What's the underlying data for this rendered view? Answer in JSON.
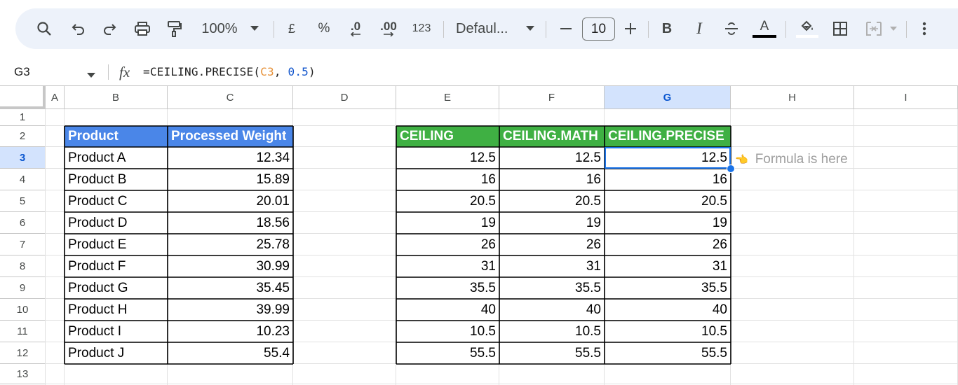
{
  "toolbar": {
    "zoom": "100%",
    "currency": "£",
    "percent": "%",
    "dec_decrease": ".0",
    "dec_increase": ".00",
    "number_format": "123",
    "font_name": "Defaul...",
    "minus": "—",
    "font_size": "10",
    "plus": "+",
    "bold": "B",
    "italic": "I",
    "text_color": "A"
  },
  "formula_bar": {
    "cell_ref": "G3",
    "fx": "fx",
    "formula_prefix": "=CEILING.PRECISE(",
    "formula_ref": "C3",
    "formula_sep": ", ",
    "formula_num": "0.5",
    "formula_suffix": ")"
  },
  "columns": [
    "A",
    "B",
    "C",
    "D",
    "E",
    "F",
    "G",
    "H",
    "I"
  ],
  "selected_column": "G",
  "rows": [
    "1",
    "2",
    "3",
    "4",
    "5",
    "6",
    "7",
    "8",
    "9",
    "10",
    "11",
    "12",
    "13"
  ],
  "selected_row": "3",
  "left_table": {
    "headers": [
      "Product",
      "Processed Weight"
    ],
    "rows": [
      [
        "Product A",
        "12.34"
      ],
      [
        "Product B",
        "15.89"
      ],
      [
        "Product C",
        "20.01"
      ],
      [
        "Product D",
        "18.56"
      ],
      [
        "Product E",
        "25.78"
      ],
      [
        "Product F",
        "30.99"
      ],
      [
        "Product G",
        "35.45"
      ],
      [
        "Product H",
        "39.99"
      ],
      [
        "Product I",
        "10.23"
      ],
      [
        "Product J",
        "55.4"
      ]
    ],
    "header_color": "#4a86e8"
  },
  "right_table": {
    "headers": [
      "CEILING",
      "CEILING.MATH",
      "CEILING.PRECISE"
    ],
    "rows": [
      [
        "12.5",
        "12.5",
        "12.5"
      ],
      [
        "16",
        "16",
        "16"
      ],
      [
        "20.5",
        "20.5",
        "20.5"
      ],
      [
        "19",
        "19",
        "19"
      ],
      [
        "26",
        "26",
        "26"
      ],
      [
        "31",
        "31",
        "31"
      ],
      [
        "35.5",
        "35.5",
        "35.5"
      ],
      [
        "40",
        "40",
        "40"
      ],
      [
        "10.5",
        "10.5",
        "10.5"
      ],
      [
        "55.5",
        "55.5",
        "55.5"
      ]
    ],
    "header_color": "#3fb043"
  },
  "note": {
    "icon": "pointing-hand-icon",
    "icon_glyph": "👈",
    "text": "Formula is here"
  },
  "colors": {
    "selection": "#1a73e8",
    "header_selected_bg": "#d3e3fd"
  }
}
